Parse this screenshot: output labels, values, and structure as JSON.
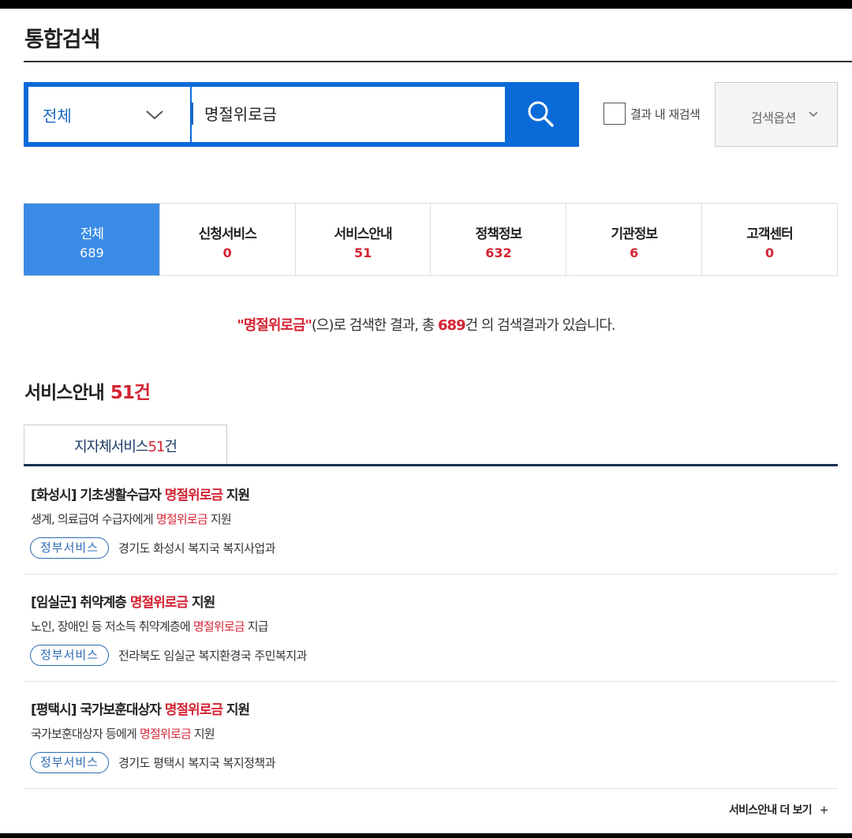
{
  "page": {
    "title": "통합검색"
  },
  "search": {
    "scope": "전체",
    "query": "명절위로금",
    "rescan_label": "결과 내 재검색",
    "options_label": "검색옵션"
  },
  "tabs": [
    {
      "name": "전체",
      "count": "689",
      "active": true
    },
    {
      "name": "신청서비스",
      "count": "0",
      "active": false
    },
    {
      "name": "서비스안내",
      "count": "51",
      "active": false
    },
    {
      "name": "정책정보",
      "count": "632",
      "active": false
    },
    {
      "name": "기관정보",
      "count": "6",
      "active": false
    },
    {
      "name": "고객센터",
      "count": "0",
      "active": false
    }
  ],
  "summary": {
    "keyword": "\"명절위로금\"",
    "text1": "(으)로 검색한 결과, 총 ",
    "total": "689",
    "text2": "건 의 검색결과가 있습니다."
  },
  "section": {
    "title": "서비스안내",
    "count": "51건",
    "subtab_label": "지자체서비스",
    "subtab_count": "51",
    "subtab_unit": "건"
  },
  "results": [
    {
      "title_prefix": "[화성시] 기초생활수급자 ",
      "title_keyword": "명절위로금",
      "title_suffix": " 지원",
      "desc_prefix": "생계, 의료급여 수급자에게 ",
      "desc_keyword": "명절위로금",
      "desc_suffix": " 지원",
      "badge": "정부서비스",
      "agency": "경기도 화성시 복지국 복지사업과"
    },
    {
      "title_prefix": "[임실군] 취약계층 ",
      "title_keyword": "명절위로금",
      "title_suffix": " 지원",
      "desc_prefix": "노인, 장애인 등 저소득 취약계층에 ",
      "desc_keyword": "명절위로금",
      "desc_suffix": " 지급",
      "badge": "정부서비스",
      "agency": "전라북도 임실군 복지환경국 주민복지과"
    },
    {
      "title_prefix": "[평택시] 국가보훈대상자 ",
      "title_keyword": "명절위로금",
      "title_suffix": " 지원",
      "desc_prefix": "국가보훈대상자 등에게 ",
      "desc_keyword": "명절위로금",
      "desc_suffix": " 지원",
      "badge": "정부서비스",
      "agency": "경기도 평택시 복지국 복지정책과"
    }
  ],
  "more": {
    "label": "서비스안내 더 보기",
    "plus": "+"
  },
  "colors": {
    "brand_blue": "#0a6ad8",
    "active_tab": "#3a8be6",
    "highlight_red": "#d42434",
    "navy": "#1b2f4e"
  }
}
